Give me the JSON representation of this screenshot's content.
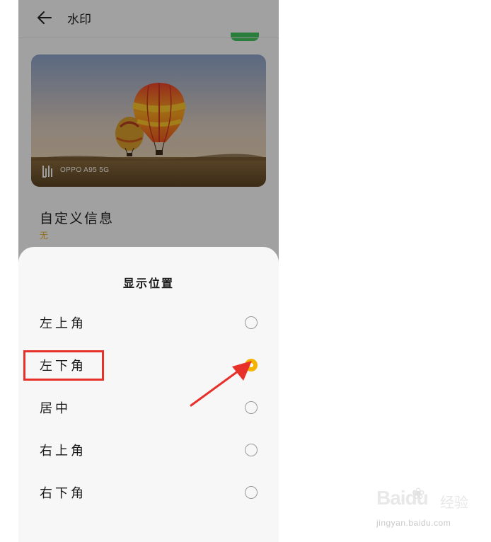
{
  "header": {
    "title": "水印"
  },
  "preview": {
    "watermark_text": "OPPO A95 5G"
  },
  "custom_info": {
    "label": "自定义信息",
    "value": "无"
  },
  "sheet": {
    "title": "显示位置",
    "options": [
      {
        "label": "左上角",
        "selected": false
      },
      {
        "label": "左下角",
        "selected": true
      },
      {
        "label": "居中",
        "selected": false
      },
      {
        "label": "右上角",
        "selected": false
      },
      {
        "label": "右下角",
        "selected": false
      }
    ]
  },
  "annotation": {
    "highlight_color": "#e8302b",
    "arrow_color": "#e8302b"
  },
  "colors": {
    "accent": "#f5b300",
    "toggle": "#3fbf5a"
  },
  "site_watermark": {
    "brand": "Baidu",
    "brand_suffix": "经验",
    "url": "jingyan.baidu.com"
  }
}
